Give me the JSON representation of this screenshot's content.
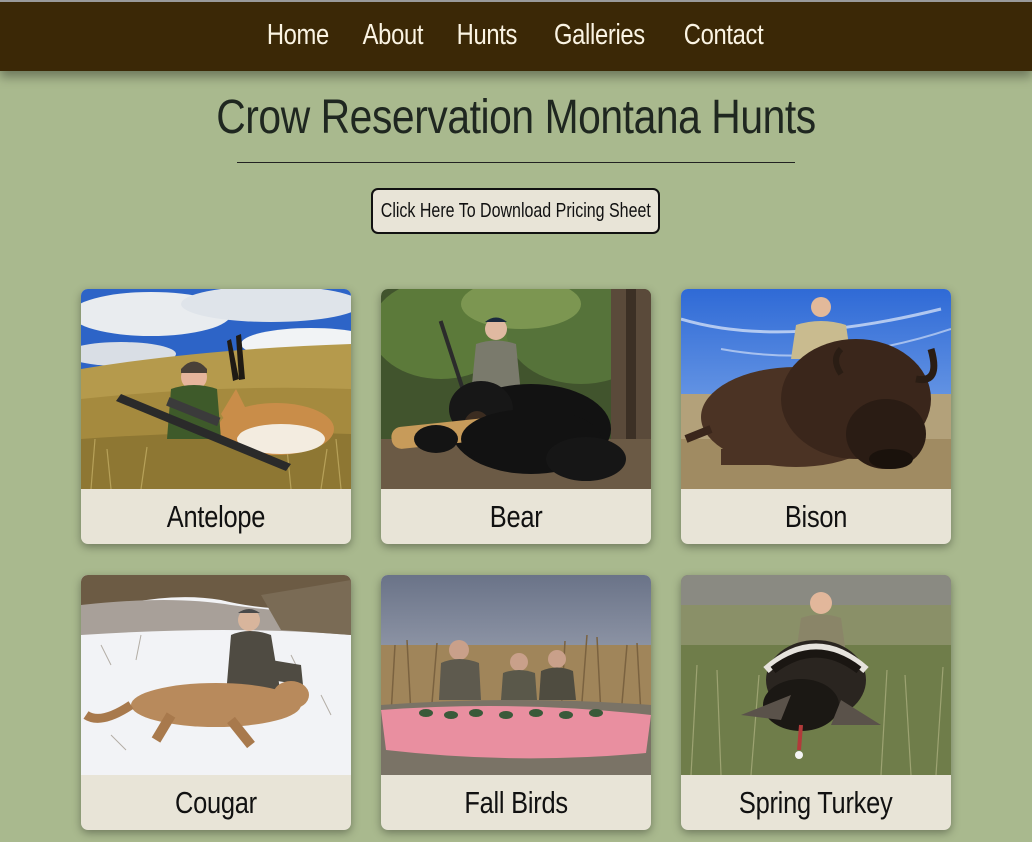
{
  "nav": {
    "items": [
      {
        "label": "Home"
      },
      {
        "label": "About"
      },
      {
        "label": "Hunts"
      },
      {
        "label": "Galleries"
      },
      {
        "label": "Contact"
      }
    ]
  },
  "header": {
    "title": "Crow Reservation Montana Hunts",
    "pricing_button": "Click Here To Download Pricing Sheet"
  },
  "hunts": [
    {
      "label": "Antelope"
    },
    {
      "label": "Bear"
    },
    {
      "label": "Bison"
    },
    {
      "label": "Cougar"
    },
    {
      "label": "Fall Birds"
    },
    {
      "label": "Spring Turkey"
    }
  ],
  "colors": {
    "page_background": "#a9b98e",
    "nav_background": "#3b2806",
    "nav_text": "#fbf4e3",
    "card_background": "#e8e4d7"
  }
}
